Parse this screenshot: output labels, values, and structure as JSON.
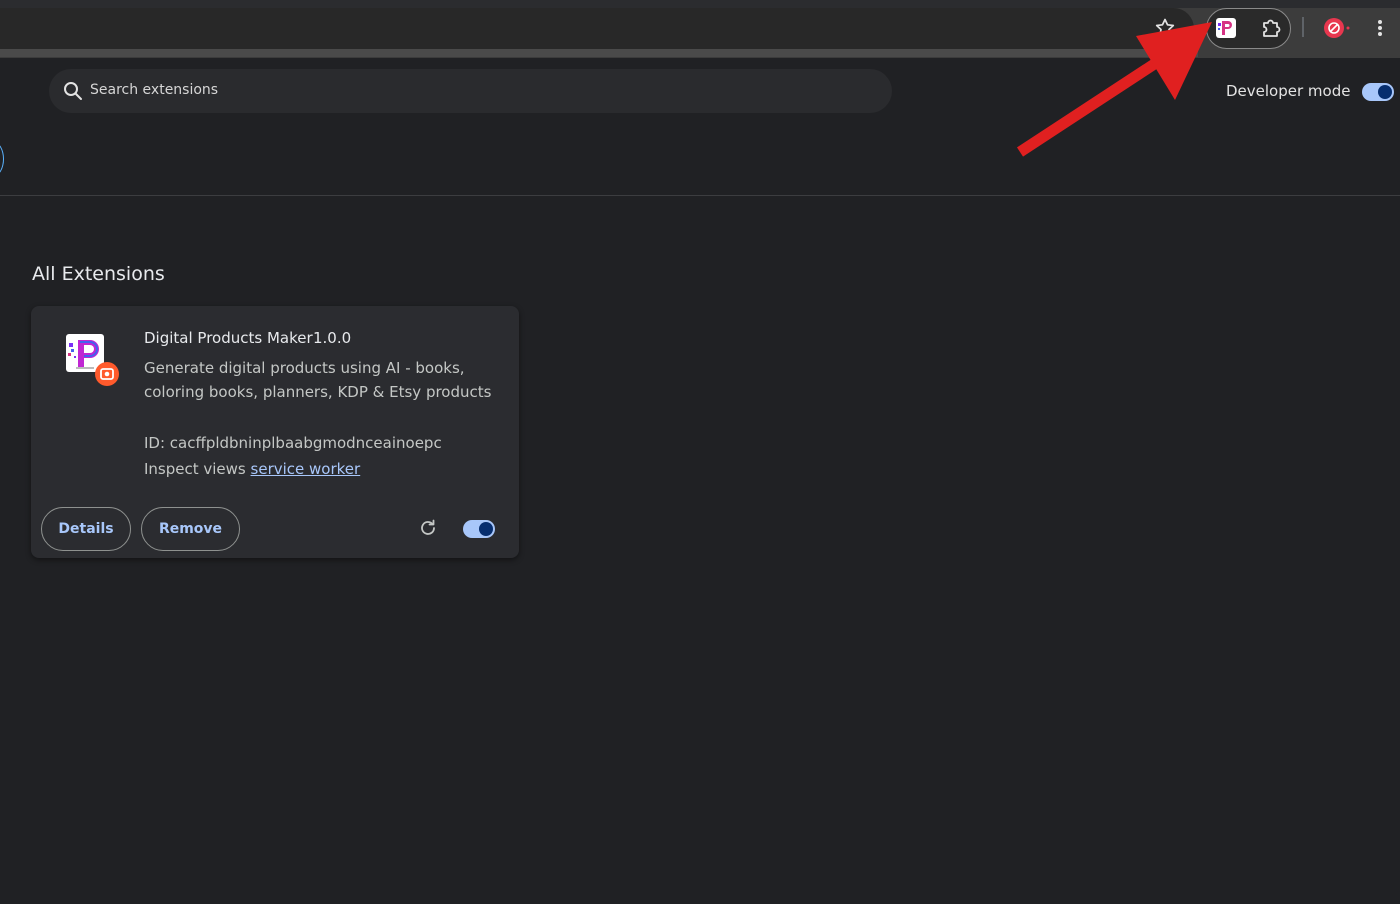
{
  "browser_toolbar": {
    "bookmark_icon": "star-outline-icon",
    "pinned_extension_icon": "digital-products-maker-icon",
    "extensions_menu_icon": "puzzle-icon",
    "profile_icon": "profile-avatar-icon",
    "menu_icon": "vertical-dots-icon"
  },
  "header": {
    "search_placeholder": "Search extensions",
    "developer_mode_label": "Developer mode",
    "developer_mode_enabled": true
  },
  "section": {
    "title": "All Extensions"
  },
  "extension": {
    "name": "Digital Products Maker",
    "version": "1.0.0",
    "description": "Generate digital products using AI - books, coloring books, planners, KDP & Etsy products",
    "id_text": "ID: cacffpldbninplbaabgmodnceainoepc",
    "inspect_label": "Inspect views",
    "inspect_link": "service worker",
    "details_label": "Details",
    "remove_label": "Remove",
    "enabled": true
  },
  "annotation": {
    "arrow_color": "#e02020"
  },
  "colors": {
    "background": "#202124",
    "card": "#2b2c30",
    "accent": "#a8c7fa"
  }
}
